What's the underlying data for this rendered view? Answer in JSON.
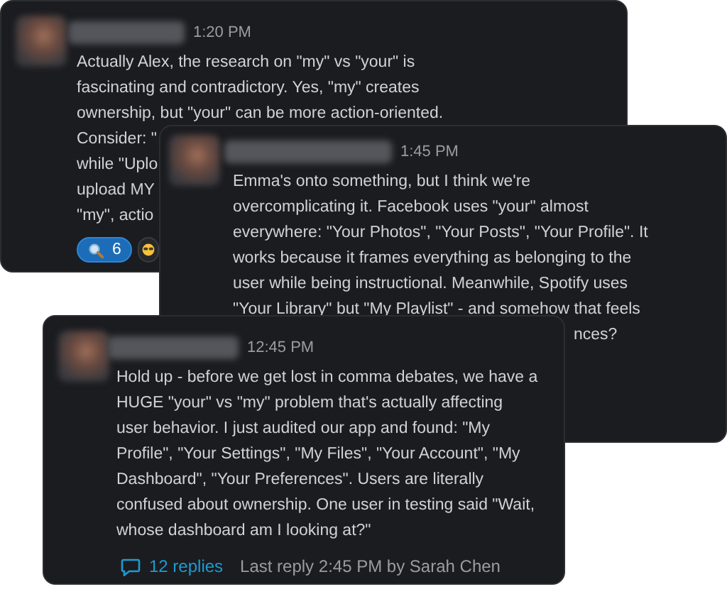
{
  "messages": [
    {
      "time": "1:20 PM",
      "lines": [
        "Actually Alex, the research on \"my\" vs \"your\" is",
        "fascinating and contradictory. Yes, \"my\" creates",
        "ownership, but \"your\" can be more action-oriented.",
        "Consider: \"",
        "while \"Uplo",
        "upload MY",
        "\"my\", actio"
      ],
      "reactions": [
        {
          "kind": "magnifier",
          "count": "6",
          "selected": true
        },
        {
          "kind": "glasses-emoji",
          "selected": false
        }
      ]
    },
    {
      "time": "1:45 PM",
      "lines": [
        "Emma's onto something, but I think we're",
        "overcomplicating it. Facebook uses \"your\" almost",
        "everywhere: \"Your Photos\", \"Your Posts\", \"Your Profile\". It",
        "works because it frames everything as belonging to the",
        "user while being instructional. Meanwhile, Spotify uses",
        "\"Your Library\" but \"My Playlist\" - and somehow that feels",
        "nces?"
      ]
    },
    {
      "time": "12:45 PM",
      "lines": [
        "Hold up - before we get lost in comma debates, we have a",
        "HUGE \"your\" vs \"my\" problem that's actually affecting",
        "user behavior. I just audited our app and found: \"My",
        "Profile\", \"Your Settings\", \"My Files\", \"Your Account\", \"My",
        "Dashboard\", \"Your Preferences\". Users are literally",
        "confused about ownership. One user in testing said \"Wait,",
        "whose dashboard am I looking at?\""
      ],
      "thread": {
        "replies": "12 replies",
        "last_reply": "Last reply 2:45 PM by Sarah Chen"
      }
    }
  ]
}
